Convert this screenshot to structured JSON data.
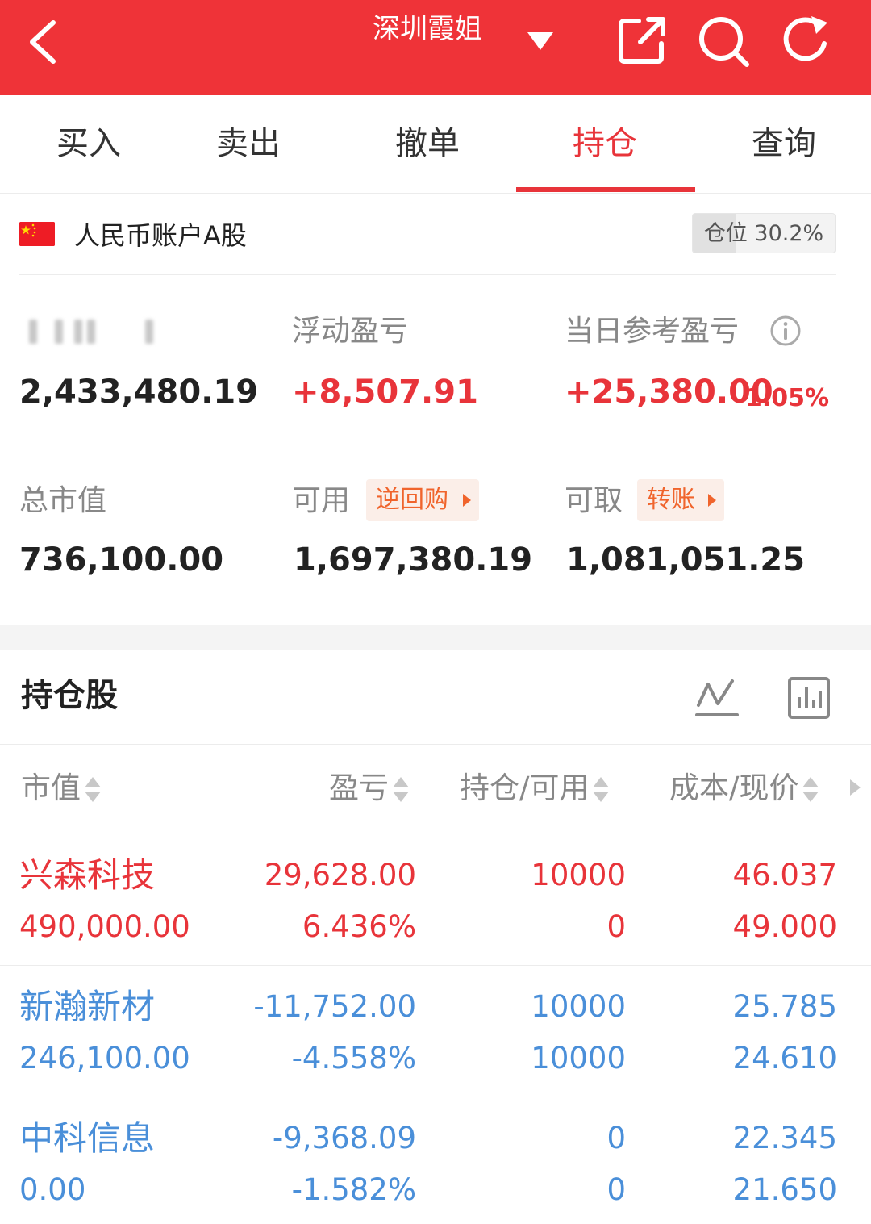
{
  "header": {
    "title": "深圳霞姐"
  },
  "tabs": [
    {
      "label": "买入"
    },
    {
      "label": "卖出"
    },
    {
      "label": "撤单"
    },
    {
      "label": "持仓"
    },
    {
      "label": "查询"
    }
  ],
  "active_tab": 3,
  "account": {
    "name": "人民币账户A股",
    "position_label": "仓位 30.2%",
    "position_ratio": 0.302
  },
  "stats": {
    "total_assets_value": "2,433,480.19",
    "floating_pnl_label": "浮动盈亏",
    "floating_pnl_value": "+8,507.91",
    "daily_pnl_label": "当日参考盈亏",
    "daily_pnl_value": "+25,380.00",
    "daily_pnl_pct": "1.05%",
    "market_value_label": "总市值",
    "market_value": "736,100.00",
    "available_label": "可用",
    "repo_button": "逆回购",
    "available_value": "1,697,380.19",
    "withdrawable_label": "可取",
    "transfer_button": "转账",
    "withdrawable_value": "1,081,051.25"
  },
  "holdings": {
    "title": "持仓股",
    "columns": [
      "市值",
      "盈亏",
      "持仓/可用",
      "成本/现价"
    ],
    "rows": [
      {
        "name": "兴森科技",
        "market_value": "490,000.00",
        "pnl": "29,628.00",
        "pnl_pct": "6.436%",
        "position": "10000",
        "available": "0",
        "cost": "46.037",
        "price": "49.000",
        "trend": "up"
      },
      {
        "name": "新瀚新材",
        "market_value": "246,100.00",
        "pnl": "-11,752.00",
        "pnl_pct": "-4.558%",
        "position": "10000",
        "available": "10000",
        "cost": "25.785",
        "price": "24.610",
        "trend": "down"
      },
      {
        "name": "中科信息",
        "market_value": "0.00",
        "pnl": "-9,368.09",
        "pnl_pct": "-1.582%",
        "position": "0",
        "available": "0",
        "cost": "22.345",
        "price": "21.650",
        "trend": "down"
      }
    ]
  },
  "colors": {
    "brand_red": "#ef3338",
    "loss_blue": "#4a8fd9",
    "tag_orange": "#f0642c"
  }
}
